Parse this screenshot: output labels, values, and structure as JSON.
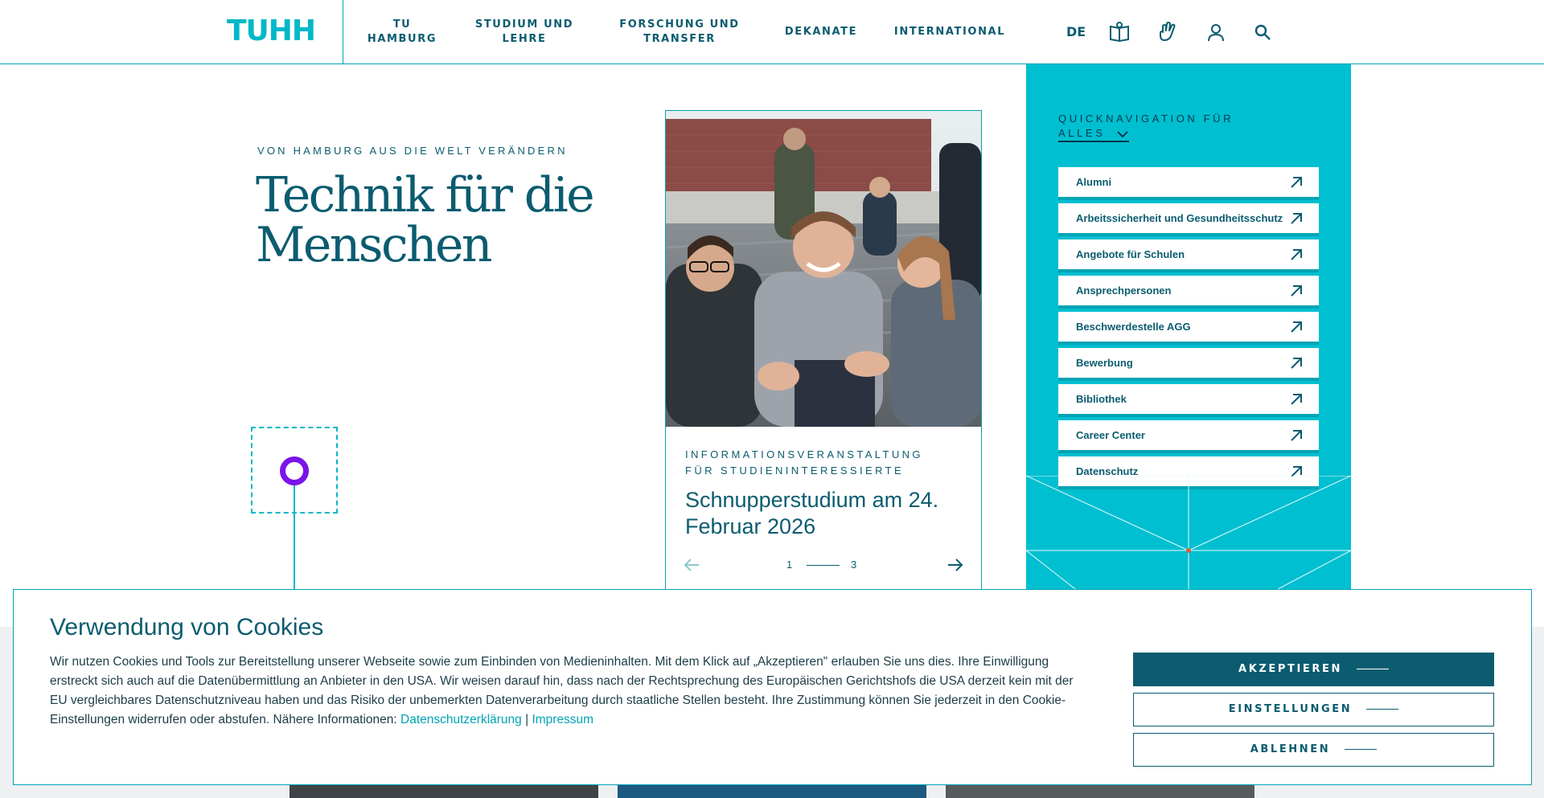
{
  "header": {
    "logo": "TUHH",
    "nav": [
      {
        "line1": "TU",
        "line2": "HAMBURG"
      },
      {
        "line1": "STUDIUM UND",
        "line2": "LEHRE"
      },
      {
        "line1": "FORSCHUNG UND",
        "line2": "TRANSFER"
      },
      {
        "line1": "DEKANATE",
        "line2": ""
      },
      {
        "line1": "INTERNATIONAL",
        "line2": ""
      }
    ],
    "language": "DE",
    "icons": [
      "easy-language-icon",
      "sign-language-icon",
      "user-icon",
      "search-icon"
    ]
  },
  "hero": {
    "kicker": "VON HAMBURG AUS DIE WELT VERÄNDERN",
    "headline_line1": "Technik für die",
    "headline_line2": "Menschen"
  },
  "teaser": {
    "kicker_line1": "INFORMATIONSVERANSTALTUNG",
    "kicker_line2": "FÜR STUDIENINTERESSIERTE",
    "title": "Schnupperstudium am 24. Februar 2026",
    "pager_current": "1",
    "pager_total": "3"
  },
  "quicknav": {
    "label": "QUICKNAVIGATION FÜR",
    "selected": "ALLES",
    "items": [
      "Alumni",
      "Arbeitssicherheit und Gesundheitsschutz",
      "Angebote für Schulen",
      "Ansprechpersonen",
      "Beschwerdestelle AGG",
      "Bewerbung",
      "Bibliothek",
      "Career Center",
      "Datenschutz"
    ]
  },
  "cookie": {
    "title": "Verwendung von Cookies",
    "text": "Wir nutzen Cookies und Tools zur Bereitstellung unserer Webseite sowie zum Einbinden von Medieninhalten. Mit dem Klick auf „Akzeptieren\" erlauben Sie uns dies. Ihre Einwilligung erstreckt sich auch auf die Datenübermittlung an Anbieter in den USA. Wir weisen darauf hin, dass nach der Rechtsprechung des Europäischen Gerichtshofs die USA derzeit kein mit der EU vergleichbares Datenschutzniveau haben und das Risiko der unbemerkten Datenverarbeitung durch staatliche Stellen besteht. Ihre Zustimmung können Sie jederzeit in den Cookie-Einstellungen widerrufen oder abstufen. Nähere Informationen: ",
    "link_privacy": "Datenschutzerklärung",
    "separator": "|",
    "link_imprint": "Impressum",
    "btn_accept": "AKZEPTIEREN",
    "btn_settings": "EINSTELLUNGEN",
    "btn_reject": "ABLEHNEN"
  },
  "colors": {
    "primary": "#0b5c70",
    "accent": "#00bfd1",
    "highlight": "#7a14e8"
  }
}
